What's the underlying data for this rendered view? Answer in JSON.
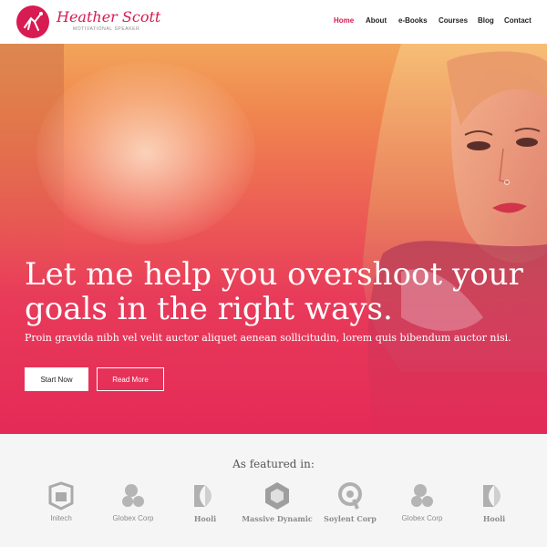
{
  "header": {
    "brand_name": "Heather Scott",
    "brand_tagline": "MOTIVATIONAL SPEAKER",
    "logo_icon": "dove-icon",
    "nav": [
      {
        "label": "Home",
        "active": true
      },
      {
        "label": "About",
        "active": false
      },
      {
        "label": "e-Books",
        "active": false
      },
      {
        "label": "Courses",
        "active": false
      },
      {
        "label": "Blog",
        "active": false
      },
      {
        "label": "Contact",
        "active": false
      }
    ]
  },
  "hero": {
    "headline_line1": "Let me help you overshoot your",
    "headline_line2": "goals in the right ways.",
    "subtext": "Proin gravida nibh vel velit auctor aliquet aenean sollicitudin, lorem quis bibendum auctor nisi.",
    "primary_button": "Start Now",
    "secondary_button": "Read More"
  },
  "featured": {
    "title": "As featured in:",
    "logos": [
      {
        "name": "Initech",
        "icon": "initech-logo-icon"
      },
      {
        "name": "Globex Corp",
        "icon": "globex-logo-icon"
      },
      {
        "name": "Hooli",
        "icon": "hooli-logo-icon"
      },
      {
        "name": "Massive Dynamic",
        "icon": "massive-dynamic-logo-icon"
      },
      {
        "name": "Soylent Corp",
        "icon": "soylent-logo-icon"
      },
      {
        "name": "Globex Corp",
        "icon": "globex-logo-icon"
      },
      {
        "name": "Hooli",
        "icon": "hooli-logo-icon"
      }
    ]
  },
  "colors": {
    "accent": "#d81b52",
    "hero_top": "#f2a45a",
    "hero_bottom": "#e42a57",
    "featured_bg": "#f6f5f6"
  }
}
